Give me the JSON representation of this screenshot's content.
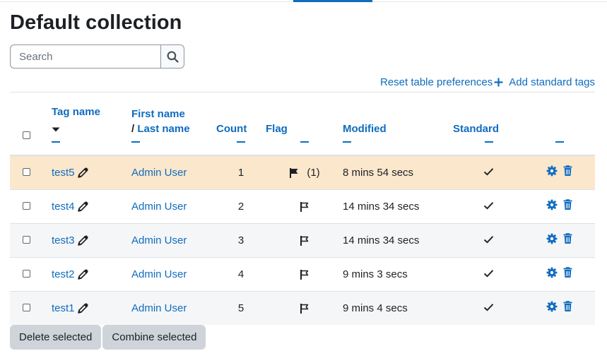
{
  "page": {
    "title": "Default collection",
    "search": {
      "placeholder": "Search"
    },
    "links": {
      "reset": "Reset table preferences",
      "add_tags": "Add standard tags"
    }
  },
  "table": {
    "headers": {
      "tag_name": "Tag name",
      "first_name": "First name",
      "slash": "/",
      "last_name": "Last name",
      "count": "Count",
      "flag": "Flag",
      "modified": "Modified",
      "standard": "Standard"
    },
    "rows": [
      {
        "tag": "test5",
        "user": "Admin User",
        "count": "1",
        "flagged": true,
        "flag_count": "(1)",
        "modified": "8 mins 54 secs"
      },
      {
        "tag": "test4",
        "user": "Admin User",
        "count": "2",
        "flagged": false,
        "flag_count": "",
        "modified": "14 mins 34 secs"
      },
      {
        "tag": "test3",
        "user": "Admin User",
        "count": "3",
        "flagged": false,
        "flag_count": "",
        "modified": "14 mins 34 secs"
      },
      {
        "tag": "test2",
        "user": "Admin User",
        "count": "4",
        "flagged": false,
        "flag_count": "",
        "modified": "9 mins 3 secs"
      },
      {
        "tag": "test1",
        "user": "Admin User",
        "count": "5",
        "flagged": false,
        "flag_count": "",
        "modified": "9 mins 4 secs"
      }
    ]
  },
  "actions": {
    "delete": "Delete selected",
    "combine": "Combine selected"
  },
  "colors": {
    "accent": "#0f6cbf",
    "highlight_row": "#fbe7cc",
    "button_bg": "#ced4da"
  },
  "icons": {
    "search": "search-icon",
    "plus": "plus-icon",
    "sort": "sort-desc-icon",
    "edit": "pencil-icon",
    "flag": "flag-icon",
    "check": "check-icon",
    "settings": "gear-icon",
    "delete": "trash-icon"
  }
}
